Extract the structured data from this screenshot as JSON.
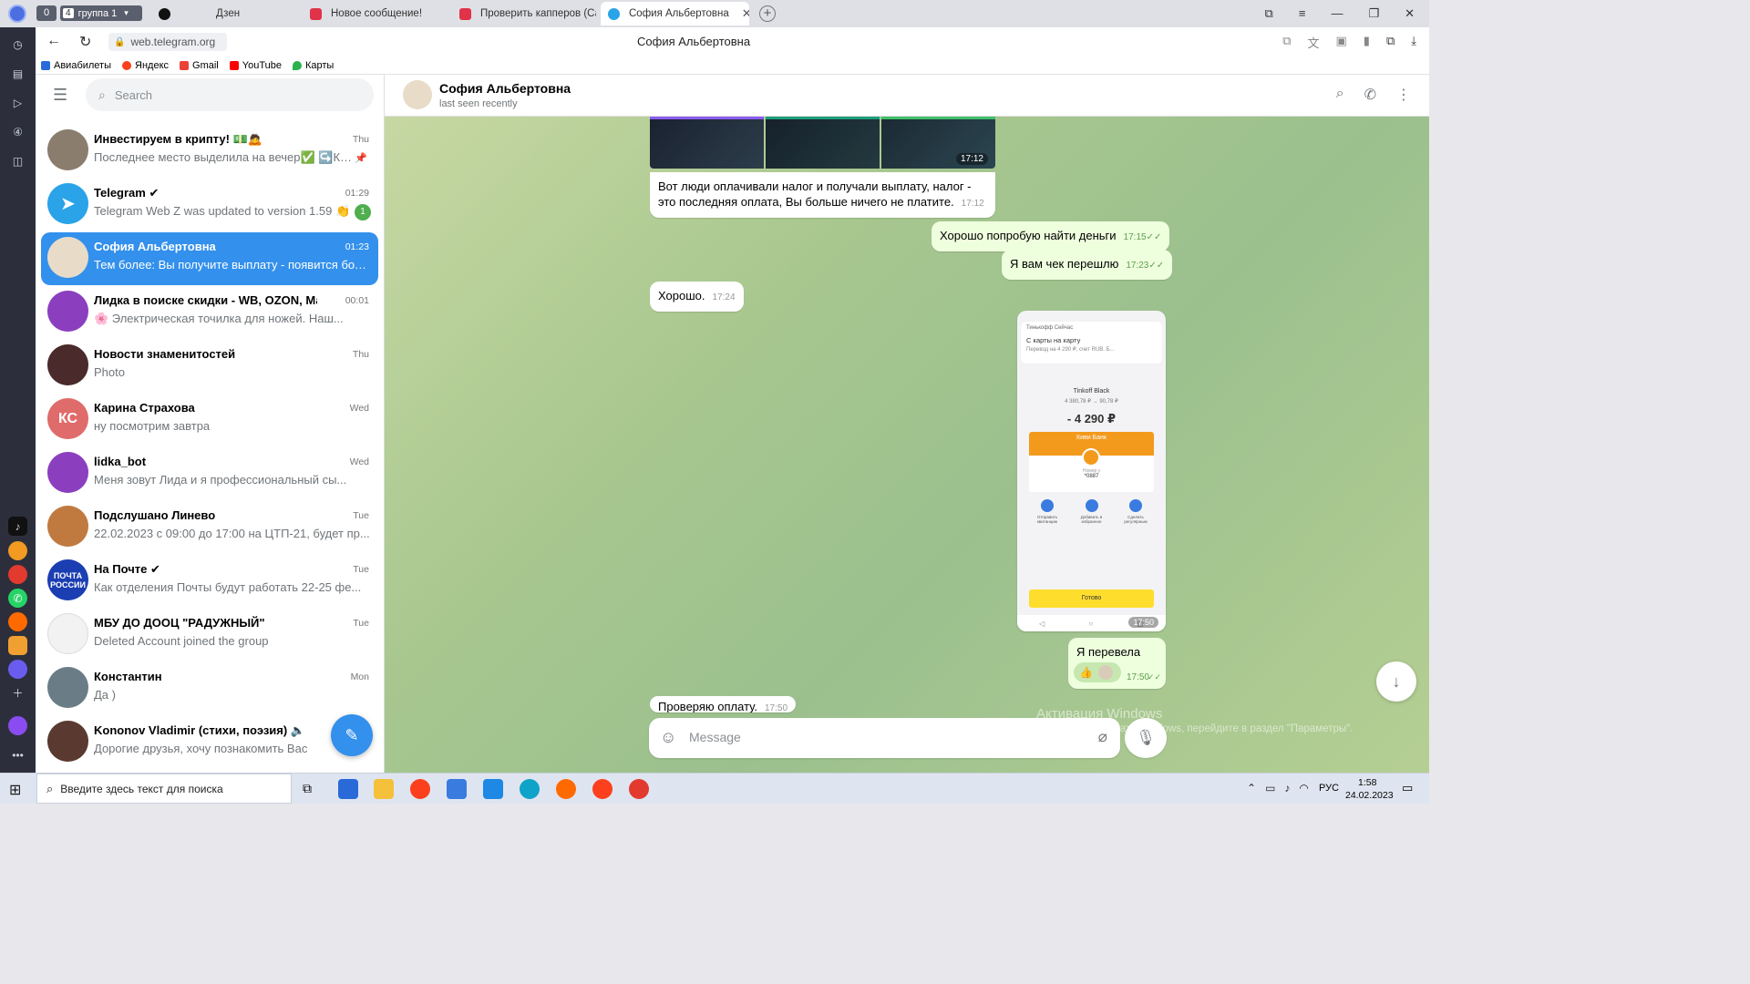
{
  "browser": {
    "tabs": {
      "counter": "0",
      "group_count": "4",
      "group_label": "группа 1",
      "t1": "Дзен",
      "t2": "Новое сообщение!",
      "t3": "Проверить капперов (Са",
      "t4": "София Альбертовна"
    },
    "url": "web.telegram.org",
    "page_title": "София Альбертовна",
    "bookmarks": [
      "Авиабилеты",
      "Яндекс",
      "Gmail",
      "YouTube",
      "Карты"
    ]
  },
  "sidebar": {
    "search_placeholder": "Search",
    "chats": [
      {
        "name": "Инвестируем в крипту! 💵🙇",
        "time": "Thu",
        "msg": "Последнее место выделила на вечер✅ ↪️Кт...",
        "avatar_color": "#8a7d6e"
      },
      {
        "name": "Telegram ✔",
        "time": "01:29",
        "msg": "Telegram Web Z was updated to version 1.59 👏",
        "badge": "1",
        "avatar_color": "#2aa3e8"
      },
      {
        "name": "София Альбертовна",
        "time": "01:23",
        "msg": "Тем более: Вы получите выплату - появится бол...",
        "avatar_color": "#c9b9a0"
      },
      {
        "name": "Лидка в поиске скидки - WB, OZON, Ма...",
        "time": "00:01",
        "msg": "🌸 Электрическая точилка для ножей. Наш...",
        "avatar_color": "#8b3fbf"
      },
      {
        "name": "Новости знаменитостей",
        "time": "Thu",
        "msg": "Photo",
        "avatar_color": "#4a2a2a"
      },
      {
        "name": "Карина Страхова",
        "time": "Wed",
        "msg": "ну посмотрим завтра",
        "initials": "КС",
        "avatar_color": "#e06b6b"
      },
      {
        "name": "lidka_bot",
        "time": "Wed",
        "msg": "Меня зовут Лида и я профессиональный сы...",
        "avatar_color": "#8b3fbf"
      },
      {
        "name": "Подслушано Линево",
        "time": "Tue",
        "msg": "22.02.2023 с 09:00 до 17:00 на ЦТП-21, будет пр...",
        "avatar_color": "#c07a40"
      },
      {
        "name": "На Почте ✔",
        "time": "Tue",
        "msg": "Как отделения Почты будут работать 22-25 фе...",
        "initials": "ПОЧТА РОССИИ",
        "avatar_color": "#1b3eb3"
      },
      {
        "name": "МБУ ДО ДООЦ \"РАДУЖНЫЙ\"",
        "time": "Tue",
        "msg": "Deleted Account joined the group",
        "avatar_color": "#f0f0f0"
      },
      {
        "name": "Константин",
        "time": "Mon",
        "msg": "Да )",
        "avatar_color": "#6a7d86"
      },
      {
        "name": "Kononov Vladimir (стихи, поэзия) 🔈",
        "time": "",
        "msg": "Дорогие друзья, хочу познакомить Вас",
        "avatar_color": "#5a3a30"
      }
    ]
  },
  "chat": {
    "name": "София Альбертовна",
    "status": "last seen recently",
    "album_time": "17:12",
    "messages": [
      {
        "dir": "in",
        "text": "Вот люди оплачивали налог и получали выплату, налог - это последняя оплата, Вы больше ничего не платите.",
        "time": "17:12"
      },
      {
        "dir": "out",
        "text": "Хорошо попробую найти деньги",
        "time": "17:15"
      },
      {
        "dir": "out",
        "text": "Я вам чек перешлю",
        "time": "17:23"
      },
      {
        "dir": "in",
        "text": "Хорошо.",
        "time": "17:24"
      },
      {
        "dir": "out",
        "text": "Я перевела",
        "time": "17:50",
        "reaction": "👍"
      },
      {
        "dir": "in",
        "text": "Проверяю оплату.",
        "time": "17:50"
      }
    ],
    "receipt": {
      "header": "Тинькофф Сейчас",
      "title": "С карты на карту",
      "subtitle": "Перевод на 4 290 ₽, счет RUB. Б...",
      "card": "Tinkoff Black",
      "balance": "4 380,78 ₽ → 90,78 ₽",
      "amount": "- 4 290 ₽",
      "bank": "Киви Банк",
      "card_label": "Номер у",
      "card_no": "*0887",
      "actions": [
        "Отправить квитанцию",
        "Добавить в избранное",
        "Сделать регулярным"
      ],
      "done": "Готово",
      "time": "17:50"
    },
    "input_placeholder": "Message",
    "watermark_title": "Активация Windows",
    "watermark_text": "Чтобы активировать Windows, перейдите в раздел \"Параметры\"."
  },
  "taskbar": {
    "search_placeholder": "Введите здесь текст для поиска",
    "lang": "РУС",
    "time": "1:58",
    "date": "24.02.2023"
  }
}
